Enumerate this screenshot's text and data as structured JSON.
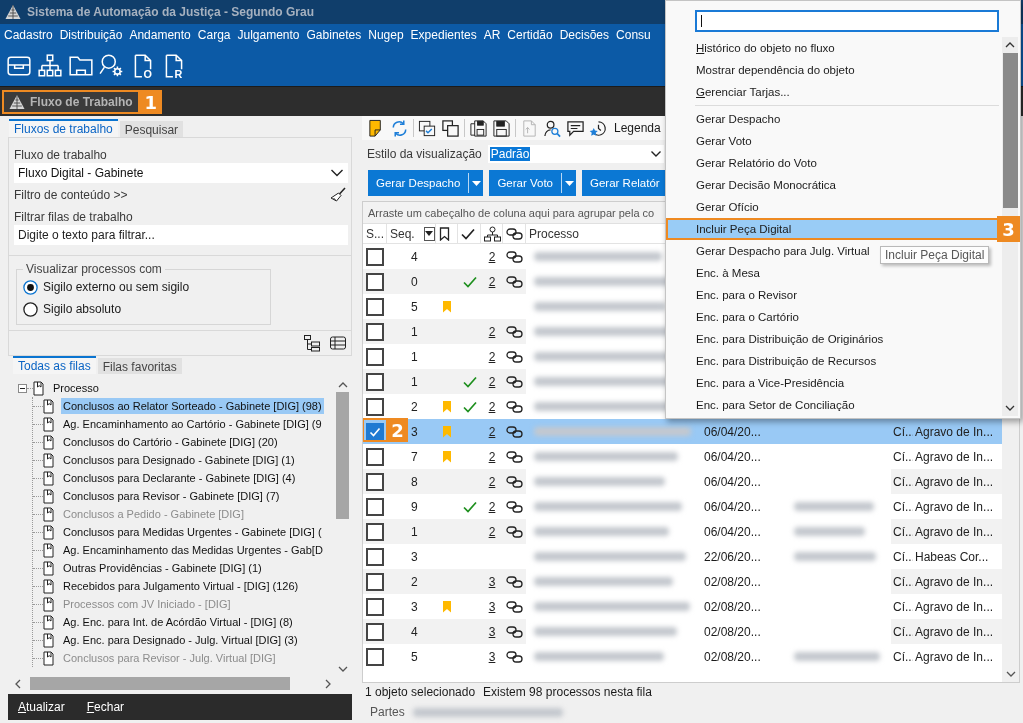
{
  "window": {
    "title": "Sistema de Automação da Justiça - Segundo Grau"
  },
  "menu_bar": {
    "items": [
      "Cadastro",
      "Distribuição",
      "Andamento",
      "Carga",
      "Julgamento",
      "Gabinetes",
      "Nugep",
      "Expedientes",
      "AR",
      "Certidão",
      "Decisões",
      "Consu"
    ]
  },
  "main_toolbar": {
    "buttons": [
      {
        "kind": "inbox"
      },
      {
        "kind": "org-chart"
      },
      {
        "kind": "folder"
      },
      {
        "kind": "search-gear"
      },
      {
        "kind": "doc-letter",
        "letter": "O"
      },
      {
        "kind": "doc-letter",
        "letter": "R"
      }
    ]
  },
  "document_tabs": [
    {
      "label": "Fluxo de Trabalho",
      "selected": true,
      "callout": "1"
    }
  ],
  "left_panel": {
    "tabs": [
      {
        "label": "Fluxos de trabalho",
        "selected": true
      },
      {
        "label": "Pesquisar",
        "selected": false
      }
    ],
    "workflow": {
      "label": "Fluxo de trabalho",
      "value": "Fluxo Digital - Gabinete"
    },
    "content_filter": {
      "label": "Filtro de conteúdo >>"
    },
    "queue_filter": {
      "label": "Filtrar filas de trabalho",
      "placeholder": "Digite o texto para filtrar..."
    },
    "visibility": {
      "legend": "Visualizar processos com",
      "options": [
        {
          "label": "Sigilo externo ou sem sigilo",
          "selected": true
        },
        {
          "label": "Sigilo absoluto",
          "selected": false
        }
      ]
    },
    "queue_tabs": [
      {
        "label": "Todas as filas",
        "selected": true
      },
      {
        "label": "Filas favoritas",
        "selected": false
      }
    ],
    "tree": [
      {
        "label": "Processo",
        "expanded": true,
        "selected": false,
        "disabled": false,
        "children": [
          {
            "label": "Conclusos ao Relator Sorteado - Gabinete [DIG] (98)",
            "selected": true,
            "disabled": false
          },
          {
            "label": "Ag. Encaminhamento ao Cartório - Gabinete [DIG] (9",
            "selected": false,
            "disabled": false
          },
          {
            "label": "Conclusos do Cartório - Gabinete [DIG] (20)",
            "selected": false,
            "disabled": false
          },
          {
            "label": "Conclusos para Designado - Gabinete [DIG] (1)",
            "selected": false,
            "disabled": false
          },
          {
            "label": "Conclusos para Declarante - Gabinete [DIG] (4)",
            "selected": false,
            "disabled": false
          },
          {
            "label": "Conclusos para Revisor - Gabinete [DIG] (7)",
            "selected": false,
            "disabled": false
          },
          {
            "label": "Conclusos a Pedido - Gabinete [DIG]",
            "selected": false,
            "disabled": true
          },
          {
            "label": "Conclusos para Medidas Urgentes - Gabinete [DIG] (",
            "selected": false,
            "disabled": false
          },
          {
            "label": "Ag. Encaminhamento das Medidas Urgentes - Gab[D",
            "selected": false,
            "disabled": false
          },
          {
            "label": "Outras Providências - Gabinete [DIG] (1)",
            "selected": false,
            "disabled": false
          },
          {
            "label": "Recebidos para Julgamento Virtual - [DIG] (126)",
            "selected": false,
            "disabled": false
          },
          {
            "label": "Processos com JV Iniciado - [DIG]",
            "selected": false,
            "disabled": true
          },
          {
            "label": "Ag. Enc. para Int. de Acórdão Virtual - [DIG] (8)",
            "selected": false,
            "disabled": false
          },
          {
            "label": "Ag. Enc. para Designado - Julg. Virtual [DIG] (3)",
            "selected": false,
            "disabled": false
          },
          {
            "label": "Conclusos para Revisor - Julg. Virtual [DIG]",
            "selected": false,
            "disabled": true
          }
        ]
      }
    ],
    "footer_buttons": [
      {
        "label": "Atualizar",
        "mnemonic": true
      },
      {
        "label": "Fechar",
        "mnemonic": true
      }
    ]
  },
  "right_panel": {
    "toolbar": [
      {
        "kind": "note",
        "disabled": false
      },
      {
        "kind": "refresh",
        "disabled": false
      },
      {
        "kind": "separator"
      },
      {
        "kind": "checklist",
        "disabled": false
      },
      {
        "kind": "copy",
        "disabled": false
      },
      {
        "kind": "separator"
      },
      {
        "kind": "save-as",
        "disabled": false
      },
      {
        "kind": "save",
        "disabled": false
      },
      {
        "kind": "separator"
      },
      {
        "kind": "document",
        "disabled": true
      },
      {
        "kind": "user-search",
        "disabled": false
      },
      {
        "kind": "comment",
        "disabled": false
      },
      {
        "kind": "star-history",
        "disabled": false
      },
      {
        "kind": "text",
        "label": "Legenda",
        "disabled": false
      }
    ],
    "view_style": {
      "label": "Estilo da visualização",
      "value": "Padrão",
      "value_highlighted": true
    },
    "action_buttons": [
      {
        "label": "Gerar Despacho",
        "split": true
      },
      {
        "label": "Gerar Voto",
        "split": true
      },
      {
        "label": "Gerar Relatór",
        "split": false
      }
    ],
    "grid": {
      "group_hint": "Arraste um cabeçalho de coluna aqui para agrupar pela co",
      "columns": [
        {
          "kind": "select",
          "label": "S..."
        },
        {
          "kind": "seq",
          "label": "Seq."
        },
        {
          "kind": "flag"
        },
        {
          "kind": "done"
        },
        {
          "kind": "count"
        },
        {
          "kind": "link"
        },
        {
          "kind": "text",
          "label": "Processo"
        }
      ],
      "rows": [
        {
          "seq": "4",
          "selected": false,
          "checked": false,
          "flagged": false,
          "done": false,
          "count": "2",
          "linked": true,
          "processo_blurred": true
        },
        {
          "seq": "0",
          "selected": false,
          "checked": false,
          "flagged": false,
          "done": true,
          "count": "2",
          "linked": true,
          "processo_blurred": true
        },
        {
          "seq": "5",
          "selected": false,
          "checked": false,
          "flagged": true,
          "done": false,
          "linked": false,
          "processo_blurred": true
        },
        {
          "seq": "1",
          "selected": false,
          "checked": false,
          "flagged": false,
          "done": false,
          "count": "2",
          "linked": true,
          "processo_blurred": true
        },
        {
          "seq": "1",
          "selected": false,
          "checked": false,
          "flagged": false,
          "done": false,
          "count": "2",
          "linked": true,
          "processo_blurred": true
        },
        {
          "seq": "1",
          "selected": false,
          "checked": false,
          "flagged": false,
          "done": true,
          "count": "2",
          "linked": true,
          "processo_blurred": true
        },
        {
          "seq": "2",
          "selected": false,
          "checked": false,
          "flagged": true,
          "done": true,
          "count": "2",
          "linked": true,
          "processo_blurred": true
        },
        {
          "seq": "3",
          "selected": true,
          "checked": true,
          "callout": "2",
          "flagged": true,
          "done": false,
          "count": "2",
          "linked": true,
          "processo_blurred": true,
          "date": "06/04/20...",
          "col_8_blurred": false,
          "col_9": "Cí...",
          "col_10": "Agravo de In..."
        },
        {
          "seq": "7",
          "selected": false,
          "checked": false,
          "flagged": true,
          "done": false,
          "count": "2",
          "linked": true,
          "processo_blurred": true,
          "date": "06/04/20...",
          "col_8_blurred": false,
          "col_9": "Cí...",
          "col_10": "Agravo de In..."
        },
        {
          "seq": "8",
          "selected": false,
          "checked": false,
          "flagged": false,
          "done": false,
          "count": "2",
          "linked": true,
          "processo_blurred": true,
          "date": "06/04/20...",
          "col_8_blurred": false,
          "col_9": "Cí...",
          "col_10": "Agravo de In..."
        },
        {
          "seq": "9",
          "selected": false,
          "checked": false,
          "flagged": false,
          "done": true,
          "count": "2",
          "linked": true,
          "processo_blurred": true,
          "date": "06/04/20...",
          "col_8_blurred": true,
          "col_9": "Cí...",
          "col_10": "Agravo de In..."
        },
        {
          "seq": "1",
          "selected": false,
          "checked": false,
          "flagged": false,
          "done": false,
          "count": "2",
          "linked": true,
          "processo_blurred": true,
          "date": "06/04/20...",
          "col_8_blurred": true,
          "col_9": "Cí...",
          "col_10": "Agravo de In..."
        },
        {
          "seq": "3",
          "selected": false,
          "checked": false,
          "flagged": false,
          "done": false,
          "linked": false,
          "processo_blurred": true,
          "date": "22/06/20...",
          "col_8_blurred": true,
          "col_9": "Cí...",
          "col_10": "Habeas Cor..."
        },
        {
          "seq": "2",
          "selected": false,
          "checked": false,
          "flagged": false,
          "done": false,
          "count": "3",
          "linked": true,
          "processo_blurred": true,
          "date": "02/08/20...",
          "col_8_blurred": false,
          "col_9": "Cí...",
          "col_10": "Agravo de In..."
        },
        {
          "seq": "3",
          "selected": false,
          "checked": false,
          "flagged": true,
          "done": false,
          "count": "3",
          "linked": true,
          "processo_blurred": true,
          "date": "02/08/20...",
          "col_8_blurred": false,
          "col_9": "Cí...",
          "col_10": "Agravo de In..."
        },
        {
          "seq": "4",
          "selected": false,
          "checked": false,
          "flagged": false,
          "done": false,
          "count": "3",
          "linked": true,
          "processo_blurred": true,
          "date": "02/08/20...",
          "col_8_blurred": false,
          "col_9": "Cí...",
          "col_10": "Agravo de In..."
        },
        {
          "seq": "5",
          "selected": false,
          "checked": false,
          "flagged": false,
          "done": false,
          "count": "3",
          "linked": true,
          "processo_blurred": true,
          "date": "02/08/20...",
          "col_8_blurred": true,
          "col_9": "Cí...",
          "col_10": "Agravo de In..."
        }
      ]
    },
    "status": {
      "selection": "1 objeto selecionado",
      "total": "Existem 98 processos nesta fila"
    },
    "details": {
      "label": "Partes",
      "value_blurred": true
    }
  },
  "context_menu": {
    "search": {
      "focused": true
    },
    "items": [
      {
        "kind": "item",
        "label": "Histórico do objeto no fluxo",
        "mnemonic": true,
        "selected": false
      },
      {
        "kind": "item",
        "label": "Mostrar dependência do objeto",
        "mnemonic": false,
        "selected": false
      },
      {
        "kind": "item",
        "label": "Gerenciar Tarjas...",
        "mnemonic": true,
        "selected": false
      },
      {
        "kind": "separator"
      },
      {
        "kind": "item",
        "label": "Gerar Despacho",
        "mnemonic": false,
        "selected": false
      },
      {
        "kind": "item",
        "label": "Gerar Voto",
        "mnemonic": false,
        "selected": false
      },
      {
        "kind": "item",
        "label": "Gerar Relatório do Voto",
        "mnemonic": false,
        "selected": false
      },
      {
        "kind": "item",
        "label": "Gerar Decisão Monocrática",
        "mnemonic": false,
        "selected": false
      },
      {
        "kind": "item",
        "label": "Gerar Ofício",
        "mnemonic": false,
        "selected": false
      },
      {
        "kind": "item",
        "label": "Incluir Peça Digital",
        "mnemonic": false,
        "selected": true,
        "callout": "3"
      },
      {
        "kind": "item",
        "label": "Gerar Despacho para Julg. Virtual",
        "mnemonic": false,
        "selected": false
      },
      {
        "kind": "item",
        "label": "Enc. à Mesa",
        "mnemonic": false,
        "selected": false
      },
      {
        "kind": "item",
        "label": "Enc. para o Revisor",
        "mnemonic": false,
        "selected": false
      },
      {
        "kind": "item",
        "label": "Enc. para o Cartório",
        "mnemonic": false,
        "selected": false
      },
      {
        "kind": "item",
        "label": "Enc. para Distribuição de Originários",
        "mnemonic": false,
        "selected": false
      },
      {
        "kind": "item",
        "label": "Enc. para Distribuição de Recursos",
        "mnemonic": false,
        "selected": false
      },
      {
        "kind": "item",
        "label": "Enc. para a Vice-Presidência",
        "mnemonic": false,
        "selected": false
      },
      {
        "kind": "item",
        "label": "Enc. para Setor de Conciliação",
        "mnemonic": false,
        "selected": false
      }
    ],
    "tooltip": "Incluir Peça Digital"
  }
}
